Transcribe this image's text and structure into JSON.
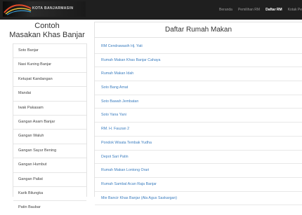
{
  "navbar": {
    "logo_text": "KOTA BANJARMASIN",
    "items": [
      {
        "label": "Beranda",
        "active": false
      },
      {
        "label": "Pemilihan RM",
        "active": false
      },
      {
        "label": "Daftar RM",
        "active": true
      },
      {
        "label": "Kotak Pe",
        "active": false
      }
    ]
  },
  "sidebar": {
    "title_line1": "Contoh",
    "title_line2": "Masakan Khas Banjar",
    "items": [
      "Soto Banjar",
      "Nasi Kuning Banjar",
      "Ketupat Kandangan",
      "Mandai",
      "Iwak Pakasam",
      "Gangan Asam Banjar",
      "Gangan Waluh",
      "Gangan Sayur Bening",
      "Gangan Humbut",
      "Gangan Paliat",
      "Karik Bilungka",
      "Patin Baubar"
    ]
  },
  "main": {
    "heading": "Daftar Rumah Makan",
    "items": [
      "RM Cendrawasih Hj. Yati",
      "Rumah Makan Khas Banjar Cahaya",
      "Rumah Makan Idah",
      "Soto Bang Amat",
      "Soto Bawah Jembatan",
      "Soto Yana Yani",
      "RM. H. Fauzan 2",
      "Pondok Wisata Tembak Yudha",
      "Depot Sari Patin",
      "Rumah Makan Lontong Orari",
      "Rumah Sambal Acan Raja Banjar",
      "Mie Bancir Khas Banjar (Ala Agus Saskargan)"
    ]
  },
  "colors": {
    "navbar_bg": "#1f1f1f",
    "link": "#3b7dbf",
    "border": "#e2e2e2"
  }
}
